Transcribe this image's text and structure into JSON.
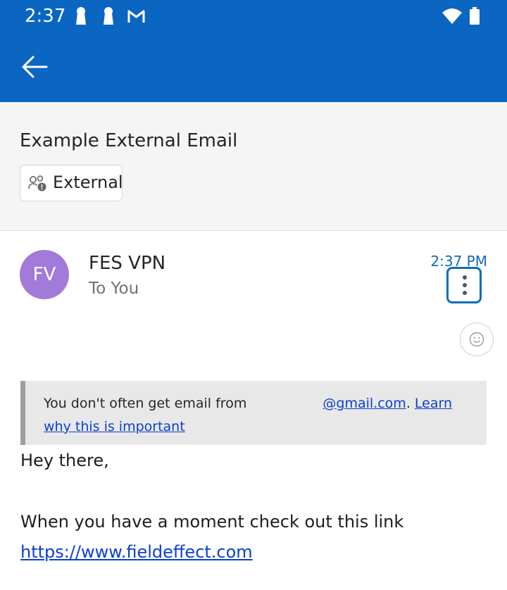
{
  "status_bar": {
    "time": "2:37",
    "icons": [
      "keyhole-icon",
      "keyhole-icon",
      "gmail-icon",
      "wifi-icon",
      "battery-icon"
    ]
  },
  "app_bar": {
    "back_icon": "arrow-left-icon"
  },
  "email": {
    "subject": "Example External Email",
    "external_label": "External",
    "external_icon": "people-warning-icon",
    "sender_initials": "FV",
    "sender_name": "FES VPN",
    "recipient": "To You",
    "time": "2:37 PM",
    "more_icon": "more-vertical-icon",
    "reaction_icon": "smiley-icon"
  },
  "banner": {
    "text_before": "You don't often get email from",
    "domain_link": "@gmail.com",
    "period": ".",
    "learn_link": "Learn why this is important"
  },
  "body": {
    "greeting": "Hey there,",
    "line": "When you have a moment check out this link",
    "link": "https://www.fieldeffect.com"
  },
  "colors": {
    "app_bar": "#0b66c2",
    "accent": "#0f6cbd",
    "avatar": "#a27ad9",
    "banner_bg": "#e8e8e8",
    "link": "#0b3fd0"
  }
}
